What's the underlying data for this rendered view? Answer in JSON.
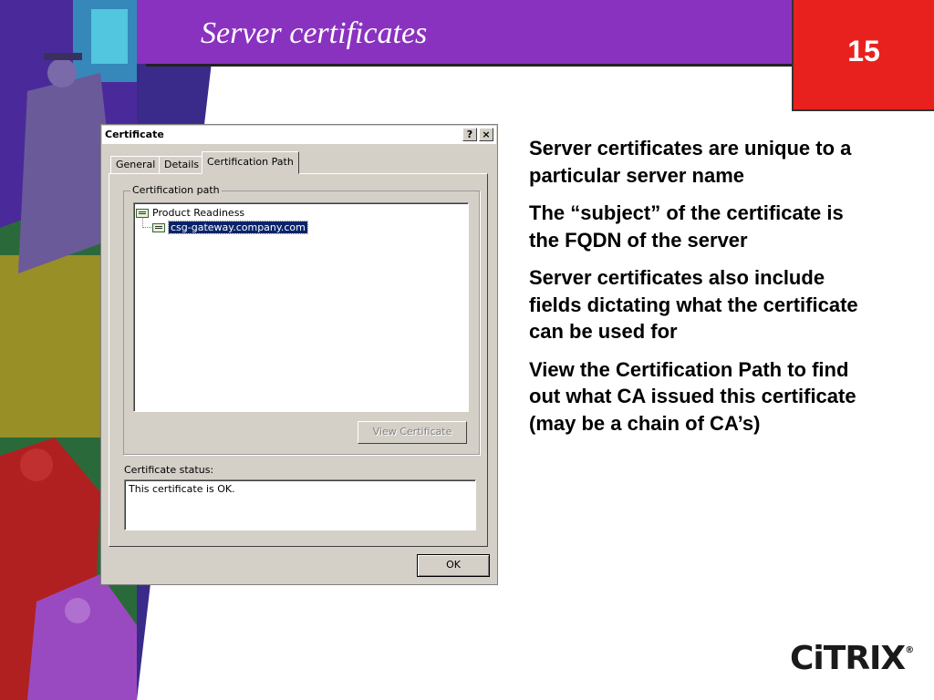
{
  "slide": {
    "title": "Server certificates",
    "page_number": "15"
  },
  "dialog": {
    "title": "Certificate",
    "help_button": "?",
    "close_button": "×",
    "tabs": [
      {
        "label": "General",
        "active": false
      },
      {
        "label": "Details",
        "active": false
      },
      {
        "label": "Certification Path",
        "active": true
      }
    ],
    "cert_path_group_label": "Certification path",
    "tree": [
      {
        "label": "Product Readiness",
        "level": 0,
        "selected": false,
        "icon": "certificate-icon"
      },
      {
        "label": "csg-gateway.company.com",
        "level": 1,
        "selected": true,
        "icon": "certificate-icon"
      }
    ],
    "view_certificate_button": "View Certificate",
    "status_label": "Certificate status:",
    "status_text": "This certificate is OK.",
    "ok_button": "OK"
  },
  "bullets": [
    "Server certificates are unique to a particular server name",
    "The “subject” of the certificate is the FQDN of the server",
    "Server certificates also include fields dictating what the certificate can be used for",
    "View the Certification Path to find out what CA issued this certificate (may be a chain of CA’s)"
  ],
  "logo": {
    "text": "CiTRIX",
    "registered": "®"
  },
  "colors": {
    "header_purple": "#8a32c0",
    "page_box_red": "#e8211f",
    "selection_blue": "#0a246a",
    "dialog_gray": "#d4d0c8"
  }
}
